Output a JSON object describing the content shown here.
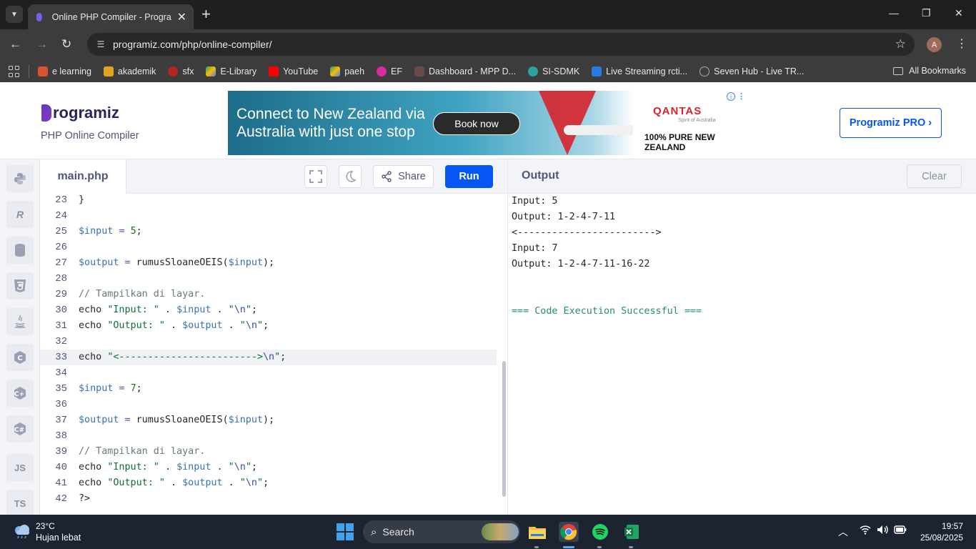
{
  "browser": {
    "tab_title": "Online PHP Compiler - Programiz",
    "url": "programiz.com/php/online-compiler/",
    "profile_initial": "A",
    "bookmarks": [
      "e learning",
      "akademik",
      "sfx",
      "E-Library",
      "YouTube",
      "paeh",
      "EF",
      "Dashboard - MPP D...",
      "SI-SDMK",
      "Live Streaming rcti...",
      "Seven Hub - Live TR..."
    ],
    "all_bookmarks": "All Bookmarks"
  },
  "site": {
    "logo": "rogramiz",
    "subtitle": "PHP Online Compiler",
    "pro_button": "Programiz PRO ›"
  },
  "ad": {
    "headline_1": "Connect to New Zealand via",
    "headline_2": "Australia with just one stop",
    "cta": "Book now",
    "brand": "QANTAS",
    "brand_sub": "Spirit of Australia",
    "tagline": "100% PURE NEW ZEALAND"
  },
  "languages": [
    "python-icon",
    "r-icon",
    "sql-icon",
    "html-icon",
    "java-icon",
    "c-icon",
    "cpp-icon",
    "csharp-icon",
    "js-icon",
    "ts-icon"
  ],
  "editor": {
    "file_name": "main.php",
    "share_label": "Share",
    "run_label": "Run",
    "active_line": 33,
    "line_numbers": [
      "23",
      "24",
      "25",
      "26",
      "27",
      "28",
      "29",
      "30",
      "31",
      "32",
      "33",
      "34",
      "35",
      "36",
      "37",
      "38",
      "39",
      "40",
      "41",
      "42"
    ],
    "lines": [
      "}",
      "",
      "$input = 5;",
      "",
      "$output = rumusSloaneOEIS($input);",
      "",
      "// Tampilkan di layar.",
      "echo \"Input: \" . $input . \"\\n\";",
      "echo \"Output: \" . $output . \"\\n\";",
      "",
      "echo \"<------------------------>\\n\";",
      "",
      "$input = 7;",
      "",
      "$output = rumusSloaneOEIS($input);",
      "",
      "// Tampilkan di layar.",
      "echo \"Input: \" . $input . \"\\n\";",
      "echo \"Output: \" . $output . \"\\n\";",
      "?>"
    ]
  },
  "output": {
    "title": "Output",
    "clear_label": "Clear",
    "lines": [
      "Input: 5",
      "Output: 1-2-4-7-11",
      "<------------------------>",
      "Input: 7",
      "Output: 1-2-4-7-11-16-22",
      "",
      "",
      "=== Code Execution Successful ==="
    ]
  },
  "taskbar": {
    "temperature": "23°C",
    "condition": "Hujan lebat",
    "search_label": "Search",
    "time": "19:57",
    "date": "25/08/2025"
  },
  "colors": {
    "run_button": "#0556f3",
    "success_text": "#259061",
    "brand_purple": "#5b3cc4"
  }
}
